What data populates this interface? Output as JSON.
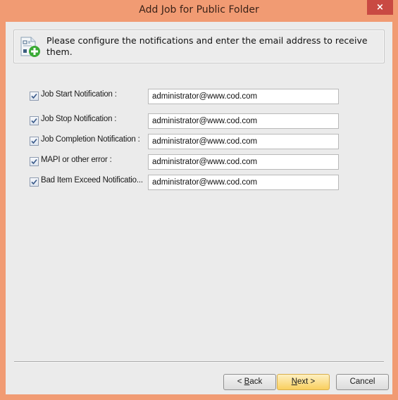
{
  "window": {
    "title": "Add Job for Public Folder",
    "close_label": "×"
  },
  "banner": {
    "icon": "document-add-icon",
    "text": "Please configure the notifications and enter the email address to receive them."
  },
  "notifications": [
    {
      "label": "Job Start Notification :",
      "checked": true,
      "email": "administrator@www.cod.com"
    },
    {
      "label": "Job Stop Notification :",
      "checked": true,
      "email": "administrator@www.cod.com"
    },
    {
      "label": "Job Completion Notification :",
      "checked": true,
      "email": "administrator@www.cod.com"
    },
    {
      "label": "MAPI or other error :",
      "checked": true,
      "email": "administrator@www.cod.com"
    },
    {
      "label": "Bad Item Exceed Notificatio...",
      "checked": true,
      "email": "administrator@www.cod.com"
    }
  ],
  "buttons": {
    "back": {
      "prefix": "< ",
      "mnemonic": "B",
      "rest": "ack"
    },
    "next": {
      "mnemonic": "N",
      "rest": "ext >"
    },
    "cancel": "Cancel"
  },
  "colors": {
    "frame": "#f19b73",
    "close": "#c94a43",
    "client": "#ebebeb",
    "primary_button": "#f9cf5e"
  }
}
